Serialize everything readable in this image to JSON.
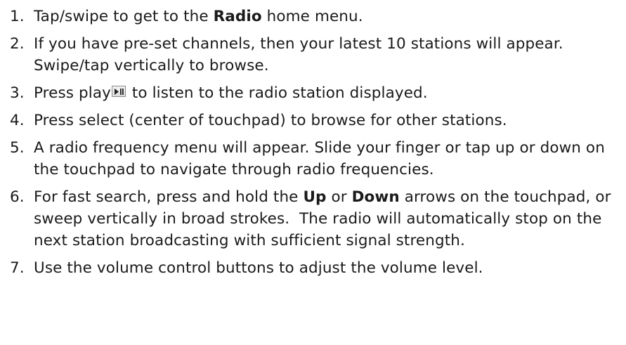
{
  "steps": [
    {
      "num": "1.",
      "segments": [
        {
          "t": "Tap/swipe to get to the "
        },
        {
          "t": "Radio",
          "b": true
        },
        {
          "t": " home menu."
        }
      ]
    },
    {
      "num": "2.",
      "segments": [
        {
          "t": "If you have pre-set channels, then your latest 10 stations will appear.  Swipe/tap vertically to browse."
        }
      ]
    },
    {
      "num": "3.",
      "segments": [
        {
          "t": "Press play"
        },
        {
          "icon": "play-pause-icon"
        },
        {
          "t": " to listen to the radio station displayed."
        }
      ]
    },
    {
      "num": "4.",
      "segments": [
        {
          "t": "Press select (center of touchpad) to browse for other stations."
        }
      ]
    },
    {
      "num": "5.",
      "segments": [
        {
          "t": "A radio frequency menu will appear. Slide your finger or tap up or down on the touchpad to navigate through radio frequencies."
        }
      ]
    },
    {
      "num": "6.",
      "segments": [
        {
          "t": "For fast search, press and hold the "
        },
        {
          "t": "Up",
          "b": true
        },
        {
          "t": " or "
        },
        {
          "t": "Down",
          "b": true
        },
        {
          "t": " arrows on the touchpad, or sweep vertically in broad strokes.  The radio will automatically stop on the next station broadcasting with sufficient signal strength."
        }
      ]
    },
    {
      "num": "7.",
      "segments": [
        {
          "t": "Use the volume control buttons to adjust the volume level."
        }
      ]
    }
  ]
}
